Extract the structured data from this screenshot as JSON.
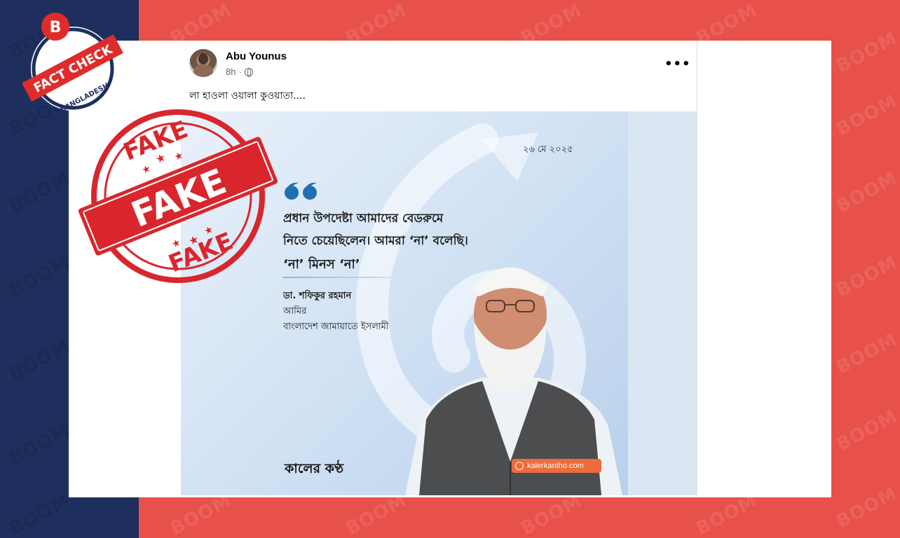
{
  "badge": {
    "letter": "B",
    "label": "FACT CHECK",
    "country": "BANGLADESH"
  },
  "watermark": "BOOM",
  "stamp": {
    "top": "FAKE",
    "center": "FAKE",
    "bottom": "FAKE"
  },
  "post": {
    "author": "Abu Younus",
    "time": "8h",
    "more": "•••",
    "caption": "লা হাওলা ওয়ালা কুওয়াতা...."
  },
  "card": {
    "date": "২৬ মে ২০২৫",
    "quote_line_1": "প্রধান উপদেষ্টা আমাদের বেডরুমে",
    "quote_line_2": "নিতে চেয়েছিলেন। আমরা ‘না’ বলেছি।",
    "quote_line_3": "‘না’ মিনস ‘না’",
    "speaker_name": "ডা. শফিকুর রহমান",
    "speaker_role": "আমির",
    "speaker_org": "বাংলাদেশ জামায়াতে ইসলামী",
    "brand": "কালের কণ্ঠ",
    "site": "kalerkantho.com"
  },
  "colors": {
    "left_band": "#1e2f5e",
    "right_band": "#e8514a",
    "stamp_red": "#d9262c",
    "site_orange": "#ee6b3b"
  },
  "icons": [
    "boom-b-icon",
    "globe-icon",
    "more-icon",
    "quote-icon",
    "kalerkantho-logo-icon"
  ]
}
